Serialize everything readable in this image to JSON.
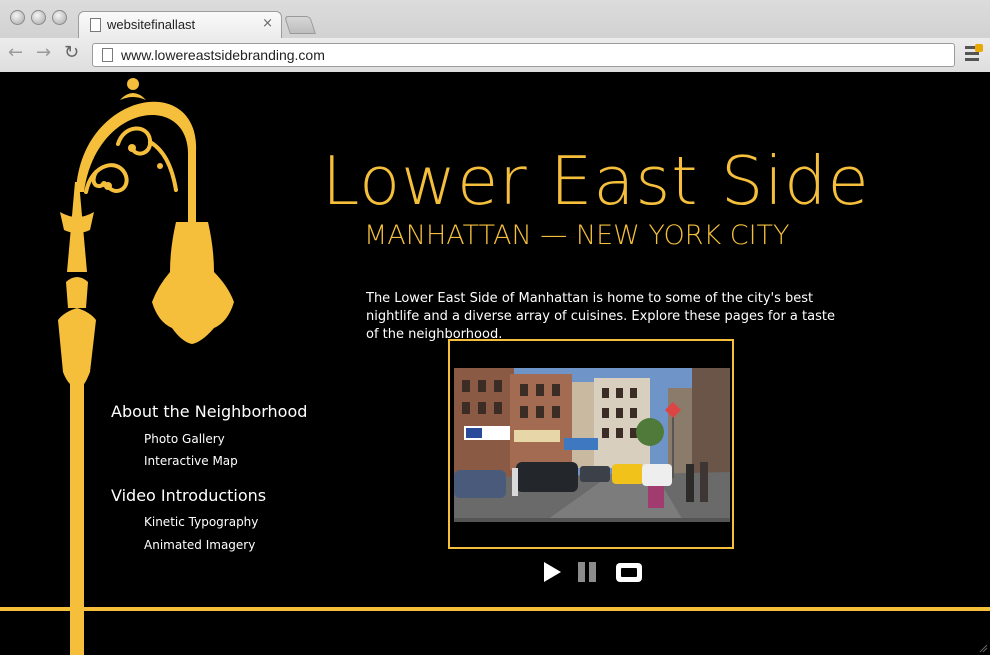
{
  "browser": {
    "tab_title": "websitefinallast",
    "tab_close": "×",
    "url": "www.lowereastsidebranding.com",
    "back_glyph": "←",
    "forward_glyph": "→",
    "reload_glyph": "↻"
  },
  "page": {
    "title": "Lower East Side",
    "subtitle": "MANHATTAN — NEW YORK CITY",
    "intro": "The Lower East Side of Manhattan is home to some of the city's best nightlife and a diverse array of cuisines.  Explore these pages for a taste of the neighborhood.",
    "nav": [
      {
        "label": "About the Neighborhood",
        "items": [
          "Photo Gallery",
          "Interactive Map"
        ]
      },
      {
        "label": "Video Introductions",
        "items": [
          "Kinetic Typography",
          "Animated Imagery"
        ]
      }
    ],
    "video_controls": [
      "play-icon",
      "pause-icon",
      "stop-icon"
    ]
  },
  "colors": {
    "accent": "#f5bf3c",
    "background": "#000000",
    "text": "#ffffff"
  }
}
